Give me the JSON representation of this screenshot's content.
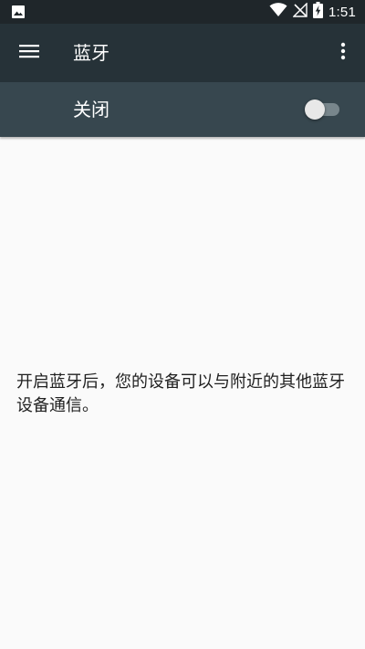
{
  "status_bar": {
    "time": "1:51",
    "icons": [
      "image-icon",
      "wifi-icon",
      "no-signal-icon",
      "battery-charging-icon"
    ]
  },
  "app_bar": {
    "title": "蓝牙",
    "menu_icon": "hamburger-menu-icon",
    "overflow_icon": "more-vert-icon"
  },
  "bluetooth_switch": {
    "label": "关闭",
    "state": "off"
  },
  "main": {
    "message": "开启蓝牙后，您的设备可以与附近的其他蓝牙设备通信。"
  },
  "colors": {
    "status_bar": "#1f262a",
    "app_bar": "#263238",
    "switch_bar": "#37474f",
    "background": "#fafafa"
  }
}
